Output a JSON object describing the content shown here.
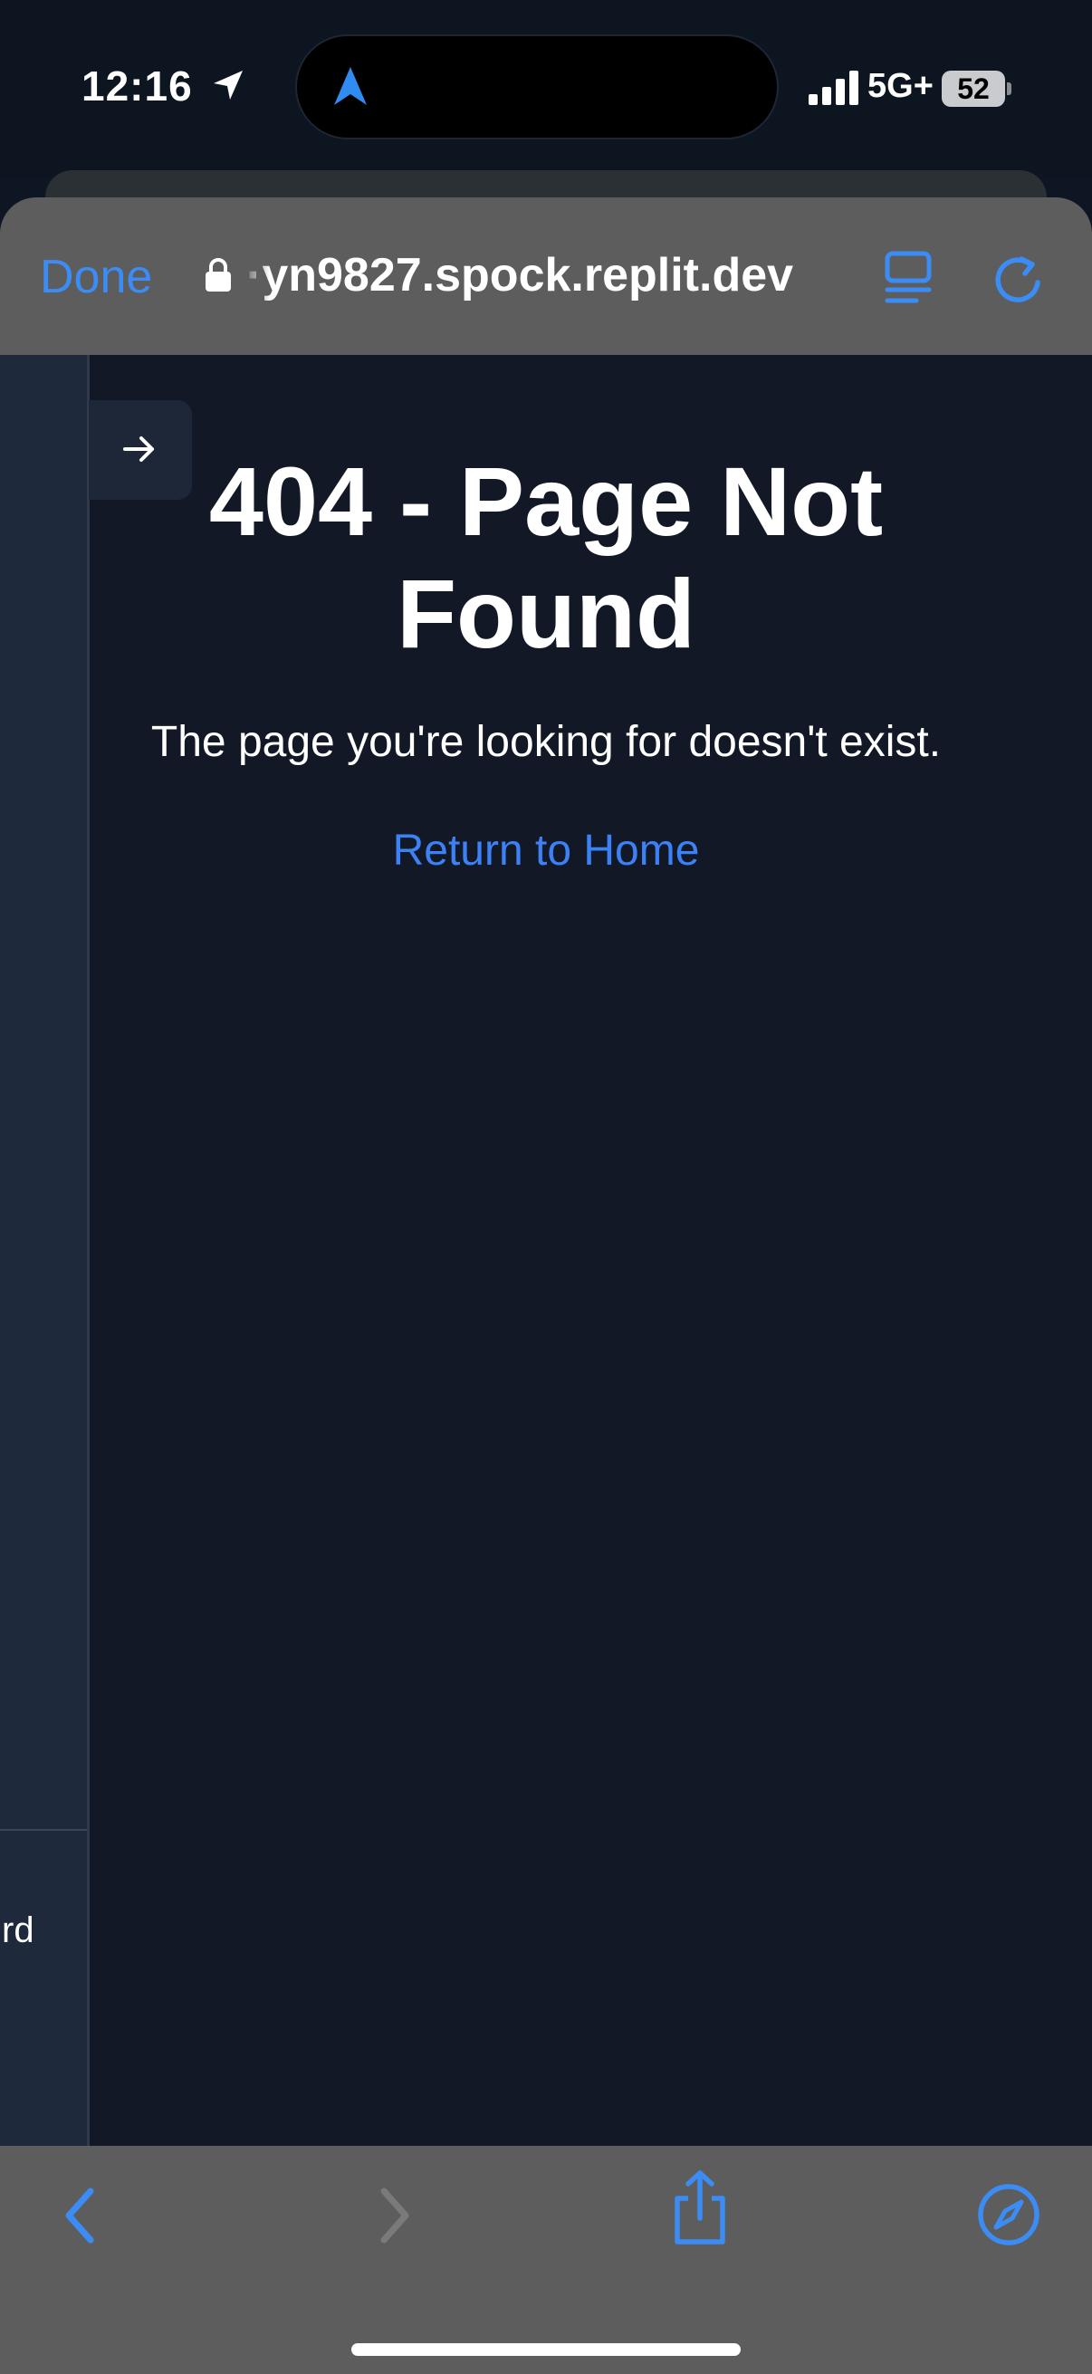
{
  "status_bar": {
    "time": "12:16",
    "network": "5G+",
    "battery": "52"
  },
  "browser": {
    "done_label": "Done",
    "url": "·yn9827.spock.replit.dev",
    "accent_color": "#3b8cf5"
  },
  "page": {
    "title": "404 - Page Not Found",
    "description": "The page you're looking for doesn't exist.",
    "home_link": "Return to Home",
    "sidebar_fragment": "rd"
  },
  "toolbar": {
    "icons": [
      "back-icon",
      "forward-icon",
      "share-icon",
      "compass-icon"
    ]
  }
}
